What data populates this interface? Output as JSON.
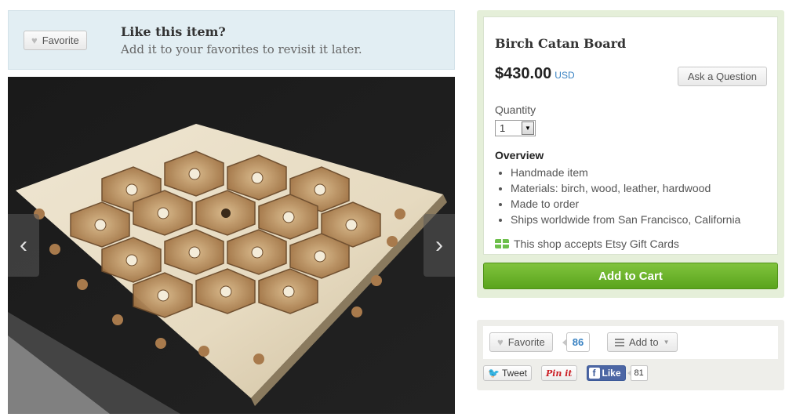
{
  "favorite_banner": {
    "button_label": "Favorite",
    "title": "Like this item?",
    "subtitle": "Add it to your favorites to revisit it later."
  },
  "image_viewer": {
    "image_description_icon": "photo",
    "prev_icon": "chevron-left-icon",
    "next_icon": "chevron-right-icon"
  },
  "listing": {
    "title": "Birch Catan Board",
    "price": "$430.00",
    "currency": "USD",
    "ask_button": "Ask a Question",
    "quantity_label": "Quantity",
    "quantity_value": "1",
    "overview_heading": "Overview",
    "overview_items": [
      "Handmade item",
      "Materials: birch, wood, leather, hardwood",
      "Made to order",
      "Ships worldwide from San Francisco, California"
    ],
    "gift_card_text": "This shop accepts Etsy Gift Cards",
    "add_to_cart": "Add to Cart"
  },
  "social": {
    "favorite_label": "Favorite",
    "favorite_count": "86",
    "add_to_label": "Add to",
    "tweet_label": "Tweet",
    "pinit_label": "Pin it",
    "like_label": "Like",
    "like_count": "81"
  },
  "colors": {
    "accent_blue": "#3a83c3",
    "cart_green": "#6ab42b",
    "banner_bg": "#e2eef3",
    "buy_box_bg": "#e5efd9"
  }
}
